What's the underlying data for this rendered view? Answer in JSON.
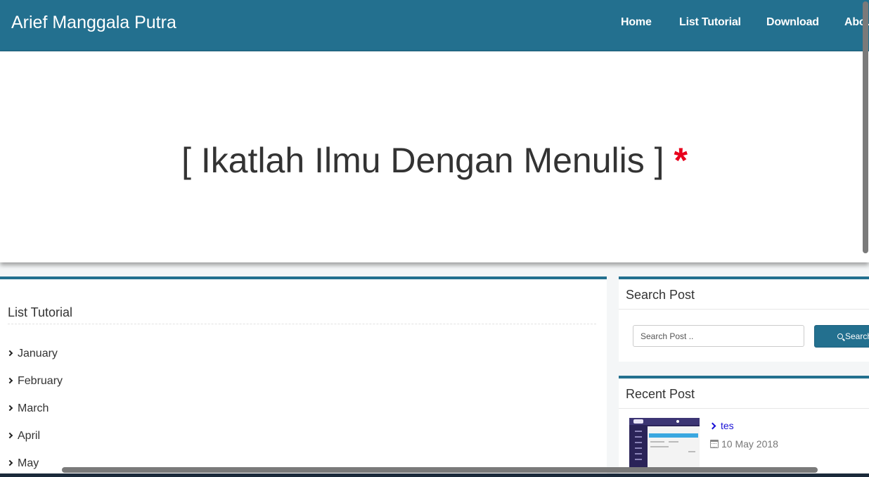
{
  "navbar": {
    "brand": "Arief Manggala Putra",
    "items": [
      {
        "label": "Home"
      },
      {
        "label": "List Tutorial"
      },
      {
        "label": "Download"
      },
      {
        "label": "About"
      }
    ],
    "color": "#23708f"
  },
  "hero": {
    "title": "[ Ikatlah Ilmu Dengan Menulis ]",
    "asterisk": "*",
    "asterisk_color": "#e8001c"
  },
  "list_tutorial": {
    "heading": "List Tutorial",
    "months": [
      "January",
      "February",
      "March",
      "April",
      "May"
    ],
    "icon": "chevron-right-icon"
  },
  "search_widget": {
    "title": "Search Post",
    "placeholder": "Search Post ..",
    "button_label": "Search",
    "button_icon": "search-icon"
  },
  "recent_widget": {
    "title": "Recent Post",
    "posts": [
      {
        "title": "tes",
        "date": "10 May 2018",
        "date_icon": "calendar-icon"
      }
    ]
  }
}
